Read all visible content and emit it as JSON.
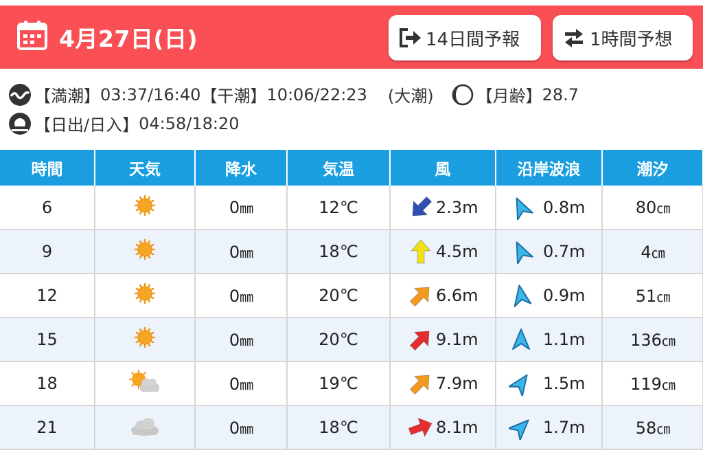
{
  "header": {
    "date": "4月27日(日)",
    "btn_14day": "14日間予報",
    "btn_1hour": "1時間予想",
    "bg_color": "#f94f55"
  },
  "tide": {
    "high_label": "【満潮】",
    "high_times": "03:37/16:40",
    "low_label": "【干潮】",
    "low_times": "10:06/22:23",
    "tide_type": "(大潮)",
    "moon_label": "【月齢】",
    "moon_age": "28.7",
    "sun_label": "【日出/日入】",
    "sun_times": "04:58/18:20"
  },
  "table": {
    "header_color": "#1a9ee0",
    "columns": [
      "時間",
      "天気",
      "降水",
      "気温",
      "風",
      "沿岸波浪",
      "潮汐"
    ],
    "rows": [
      {
        "time": "6",
        "weather": "sunny-icon",
        "precip_val": "0",
        "precip_unit": "㎜",
        "temp": "12℃",
        "wind": "2.3m",
        "wind_color": "#2d4fb5",
        "wind_dir": "arrow-down-left-icon",
        "wave": "0.8m",
        "tide_val": "80",
        "tide_unit": "㎝"
      },
      {
        "time": "9",
        "weather": "sunny-icon",
        "precip_val": "0",
        "precip_unit": "㎜",
        "temp": "18℃",
        "wind": "4.5m",
        "wind_color": "#f2e01a",
        "wind_dir": "arrow-up-icon",
        "wave": "0.7m",
        "tide_val": "4",
        "tide_unit": "㎝"
      },
      {
        "time": "12",
        "weather": "sunny-icon",
        "precip_val": "0",
        "precip_unit": "㎜",
        "temp": "20℃",
        "wind": "6.6m",
        "wind_color": "#f39a22",
        "wind_dir": "arrow-up-right-icon",
        "wave": "0.9m",
        "tide_val": "51",
        "tide_unit": "㎝"
      },
      {
        "time": "15",
        "weather": "sunny-icon",
        "precip_val": "0",
        "precip_unit": "㎜",
        "temp": "20℃",
        "wind": "9.1m",
        "wind_color": "#e52d2d",
        "wind_dir": "arrow-up-right-icon",
        "wave": "1.1m",
        "tide_val": "136",
        "tide_unit": "㎝"
      },
      {
        "time": "18",
        "weather": "partly-cloudy-icon",
        "precip_val": "0",
        "precip_unit": "㎜",
        "temp": "19℃",
        "wind": "7.9m",
        "wind_color": "#f39a22",
        "wind_dir": "arrow-up-right-icon",
        "wave": "1.5m",
        "tide_val": "119",
        "tide_unit": "㎝"
      },
      {
        "time": "21",
        "weather": "cloudy-icon",
        "precip_val": "0",
        "precip_unit": "㎜",
        "temp": "18℃",
        "wind": "8.1m",
        "wind_color": "#e52d2d",
        "wind_dir": "arrow-right-icon",
        "wave": "1.7m",
        "tide_val": "58",
        "tide_unit": "㎝"
      }
    ]
  }
}
